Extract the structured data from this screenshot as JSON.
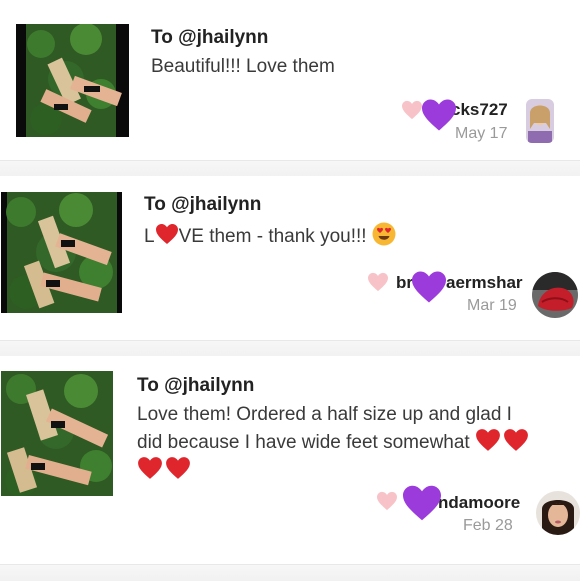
{
  "comments": [
    {
      "to": "To @jhailynn",
      "message": "Beautiful!!! Love them",
      "username": "cks727",
      "date": "May 17"
    },
    {
      "to": "To @jhailynn",
      "message_prefix": "L",
      "message_suffix": "VE them - thank you!!!",
      "username_left": "br",
      "username_right": "aermshar",
      "date": "Mar 19"
    },
    {
      "to": "To @jhailynn",
      "message_line1": "Love them! Ordered a half size up and glad I",
      "message_line2": "did because I have wide feet somewhat",
      "username": "ndamoore",
      "date": "Feb 28"
    }
  ],
  "icons": {
    "like": "heart-outline-icon",
    "overlay": "purple-heart-icon",
    "red_heart": "❤",
    "emoji": "heart-eyes-emoji"
  },
  "colors": {
    "like_pink": "#f7c3c8",
    "purple_heart": "#9b3bdc",
    "red_heart": "#e0262d"
  }
}
